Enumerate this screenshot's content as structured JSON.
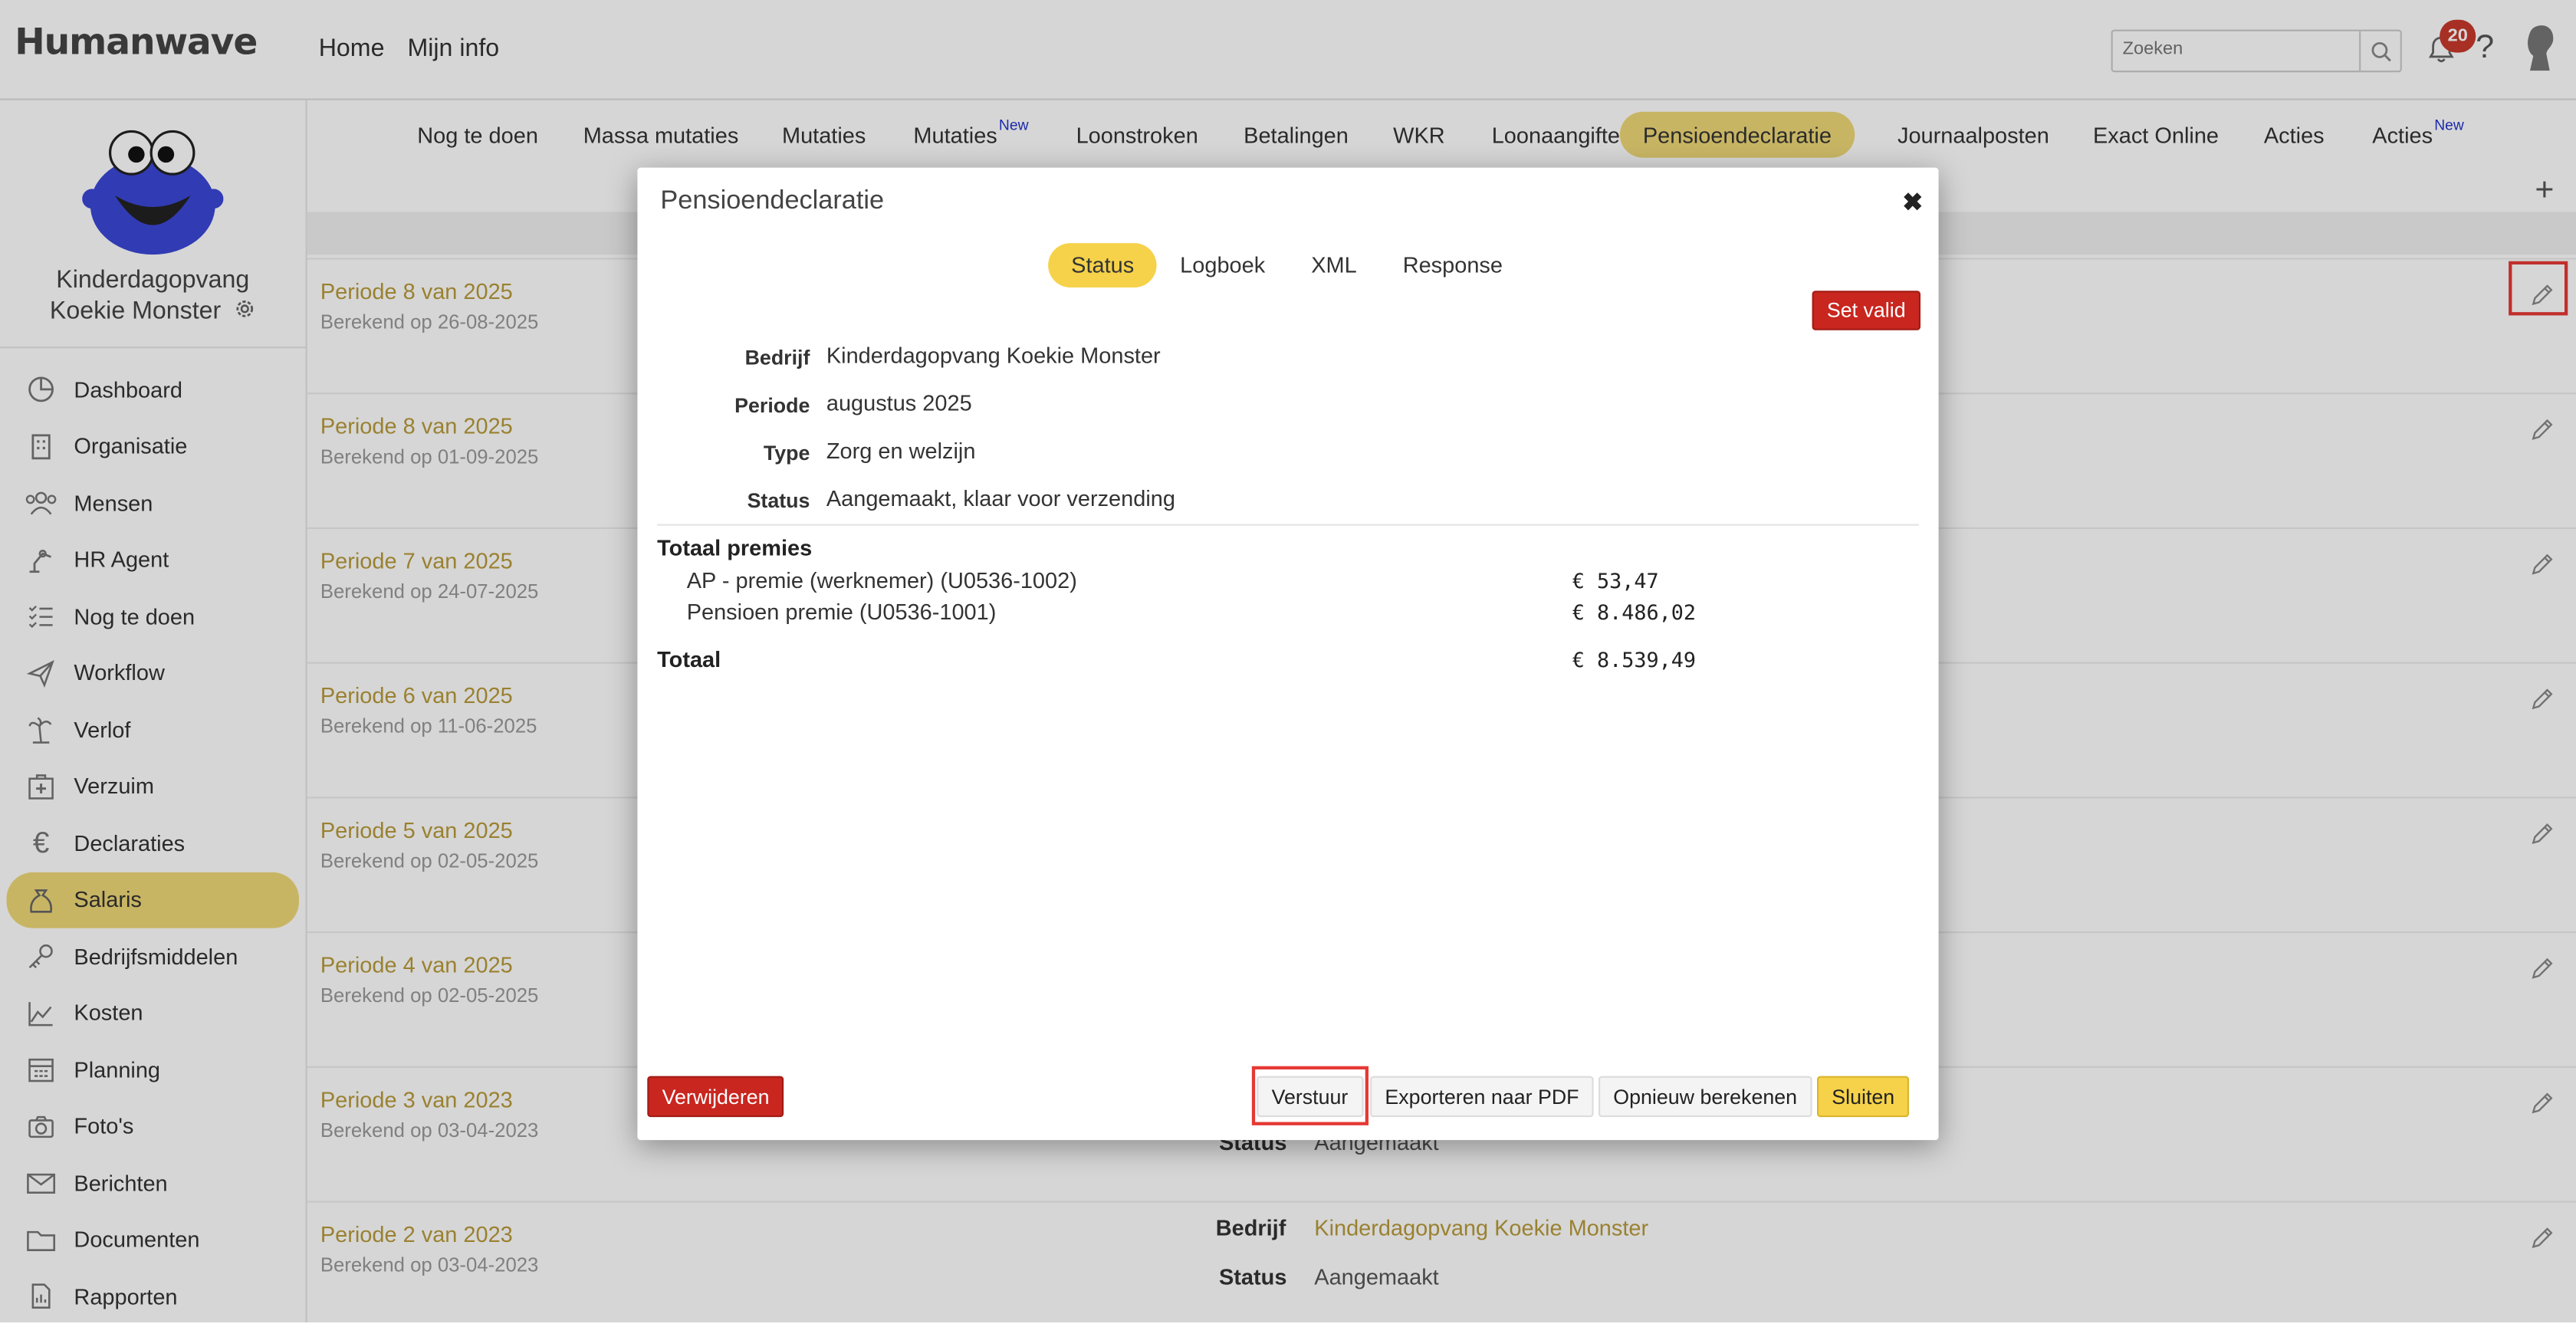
{
  "brand": {
    "logo": "Humanwave"
  },
  "topnav": {
    "home": "Home",
    "mijn_info": "Mijn info"
  },
  "search": {
    "placeholder": "Zoeken"
  },
  "notifications": {
    "count": "20"
  },
  "help": "?",
  "organization": {
    "line1": "Kinderdagopvang",
    "line2": "Koekie Monster"
  },
  "sidebar": {
    "items": [
      {
        "label": "Dashboard",
        "icon": "pie-chart-icon"
      },
      {
        "label": "Organisatie",
        "icon": "building-icon"
      },
      {
        "label": "Mensen",
        "icon": "people-icon"
      },
      {
        "label": "HR Agent",
        "icon": "robot-arm-icon"
      },
      {
        "label": "Nog te doen",
        "icon": "checklist-icon"
      },
      {
        "label": "Workflow",
        "icon": "paper-plane-icon"
      },
      {
        "label": "Verlof",
        "icon": "palm-tree-icon"
      },
      {
        "label": "Verzuim",
        "icon": "medical-kit-icon"
      },
      {
        "label": "Declaraties",
        "icon": "euro-icon"
      },
      {
        "label": "Salaris",
        "icon": "money-bag-icon"
      },
      {
        "label": "Bedrijfsmiddelen",
        "icon": "key-icon"
      },
      {
        "label": "Kosten",
        "icon": "area-chart-icon"
      },
      {
        "label": "Planning",
        "icon": "calendar-icon"
      },
      {
        "label": "Foto's",
        "icon": "camera-icon"
      },
      {
        "label": "Berichten",
        "icon": "envelope-icon"
      },
      {
        "label": "Documenten",
        "icon": "folder-icon"
      },
      {
        "label": "Rapporten",
        "icon": "report-icon"
      }
    ],
    "active_index": 9
  },
  "tabs": [
    {
      "label": "Nog te doen"
    },
    {
      "label": "Massa mutaties"
    },
    {
      "label": "Mutaties"
    },
    {
      "label": "Mutaties",
      "sup": "New"
    },
    {
      "label": "Loonstroken"
    },
    {
      "label": "Betalingen"
    },
    {
      "label": "WKR"
    },
    {
      "label": "Loonaangifte"
    },
    {
      "label": "Pensioendeclaratie"
    },
    {
      "label": "Journaalposten"
    },
    {
      "label": "Exact Online"
    },
    {
      "label": "Acties"
    },
    {
      "label": "Acties",
      "sup": "New"
    }
  ],
  "rows": [
    {
      "title": "Periode 8 van 2025",
      "sub": "Berekend op 26-08-2025"
    },
    {
      "title": "Periode 8 van 2025",
      "sub": "Berekend op 01-09-2025"
    },
    {
      "title": "Periode 7 van 2025",
      "sub": "Berekend op 24-07-2025"
    },
    {
      "title": "Periode 6 van 2025",
      "sub": "Berekend op 11-06-2025"
    },
    {
      "title": "Periode 5 van 2025",
      "sub": "Berekend op 02-05-2025"
    },
    {
      "title": "Periode 4 van 2025",
      "sub": "Berekend op 02-05-2025"
    },
    {
      "title": "Periode 3 van 2023",
      "sub": "Berekend op 03-04-2023",
      "status_label": "Status",
      "status_value": "Aangemaakt"
    },
    {
      "title": "Periode 2 van 2023",
      "sub": "Berekend op 03-04-2023",
      "bedrijf_label": "Bedrijf",
      "bedrijf_value": "Kinderdagopvang Koekie Monster",
      "status_label": "Status",
      "status_value": "Aangemaakt"
    }
  ],
  "modal": {
    "title": "Pensioendeclaratie",
    "close": "✖",
    "tabs": [
      {
        "label": "Status"
      },
      {
        "label": "Logboek"
      },
      {
        "label": "XML"
      },
      {
        "label": "Response"
      }
    ],
    "set_valid": "Set valid",
    "fields": {
      "bedrijf_label": "Bedrijf",
      "bedrijf": "Kinderdagopvang Koekie Monster",
      "periode_label": "Periode",
      "periode": "augustus 2025",
      "type_label": "Type",
      "type": "Zorg en welzijn",
      "status_label": "Status",
      "status": "Aangemaakt, klaar voor verzending"
    },
    "premies": {
      "heading": "Totaal premies",
      "lines": [
        {
          "label": "AP - premie (werknemer) (U0536-1002)",
          "amount": "€ 53,47"
        },
        {
          "label": "Pensioen premie (U0536-1001)",
          "amount": "€ 8.486,02"
        }
      ],
      "total_label": "Totaal",
      "total_amount": "€ 8.539,49"
    },
    "buttons": {
      "delete": "Verwijderen",
      "send": "Verstuur",
      "export_pdf": "Exporteren naar PDF",
      "recalculate": "Opnieuw berekenen",
      "close": "Sluiten"
    }
  },
  "colors": {
    "accent_yellow": "#f6d24a",
    "active_soft": "#efd878",
    "danger": "#c8261f",
    "period_link": "#b89a3a"
  }
}
